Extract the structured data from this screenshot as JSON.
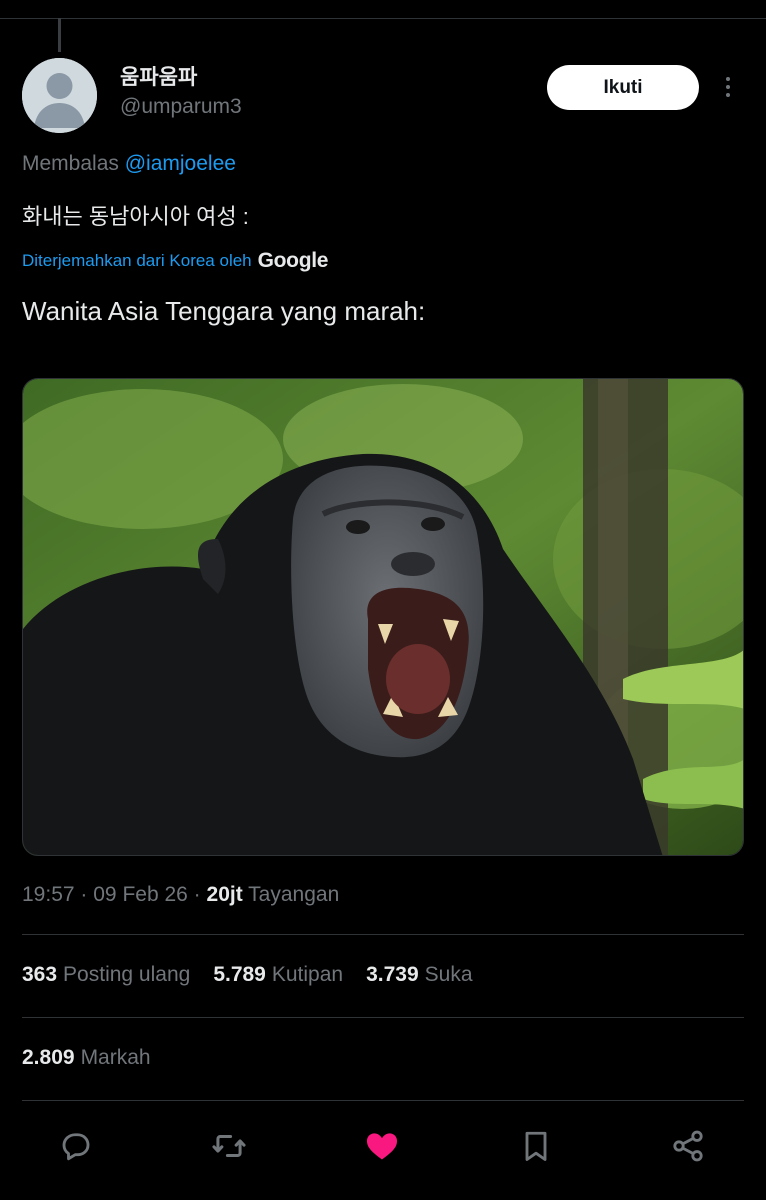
{
  "user": {
    "display_name": "움파움파",
    "handle": "@umparum3"
  },
  "follow_button": {
    "label": "Ikuti"
  },
  "reply_context": {
    "prefix": "Membalas",
    "mention": "@iamjoelee"
  },
  "post": {
    "original_text": "화내는 동남아시아 여성 :",
    "translated_notice": "Diterjemahkan dari Korea oleh",
    "translator_brand": "Google",
    "translated_text": "Wanita Asia Tenggara yang marah:"
  },
  "meta": {
    "time": "19:57",
    "separator": "·",
    "date": "09 Feb 26",
    "views_count": "20jt",
    "views_label": "Tayangan"
  },
  "stats": {
    "reposts_count": "363",
    "reposts_label": "Posting ulang",
    "quotes_count": "5.789",
    "quotes_label": "Kutipan",
    "likes_count": "3.739",
    "likes_label": "Suka",
    "bookmarks_count": "2.809",
    "bookmarks_label": "Markah"
  },
  "actions": {
    "reply_icon": "reply-icon",
    "repost_icon": "repost-icon",
    "like_icon": "heart-icon",
    "bookmark_icon": "bookmark-icon",
    "share_icon": "share-icon"
  },
  "colors": {
    "background": "#000000",
    "text_primary": "#e7e9ea",
    "text_secondary": "#71767b",
    "link": "#1d9bf0",
    "like": "#f91880",
    "divider": "#2f3336"
  }
}
